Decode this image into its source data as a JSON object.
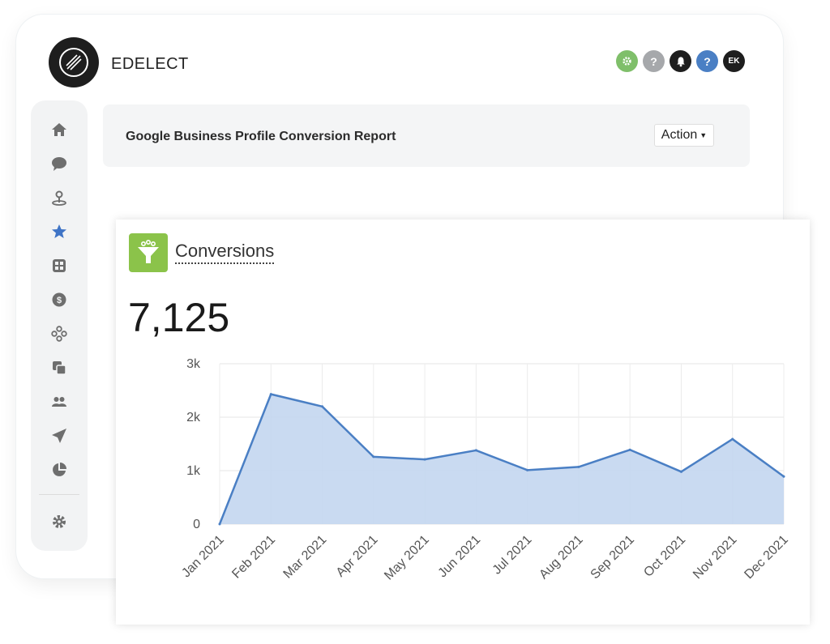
{
  "app": {
    "brand": "EDELECT"
  },
  "header": {
    "icons": [
      "settings-icon",
      "help-icon",
      "bell-icon",
      "help-icon",
      "avatar"
    ],
    "avatar_initials": "EK"
  },
  "sidebar": {
    "items": [
      "home-icon",
      "chat-icon",
      "location-pin-icon",
      "star-icon",
      "grid-icon",
      "dollar-icon",
      "share-icon",
      "copy-icon",
      "users-icon",
      "send-icon",
      "pie-chart-icon",
      "gear-icon"
    ],
    "active_item": "star-icon"
  },
  "report": {
    "title": "Google Business Profile Conversion Report",
    "action_label": "Action"
  },
  "card": {
    "label": "Conversions",
    "total": "7,125"
  },
  "colors": {
    "accent_green": "#8bc34a",
    "line_blue": "#4a7fc4",
    "area_fill": "#c3d6ef"
  },
  "chart_data": {
    "type": "area",
    "x": [
      "Jan 2021",
      "Feb 2021",
      "Mar 2021",
      "Apr 2021",
      "May 2021",
      "Jun 2021",
      "Jul 2021",
      "Aug 2021",
      "Sep 2021",
      "Oct 2021",
      "Nov 2021",
      "Dec 2021"
    ],
    "values": [
      0,
      2430,
      2200,
      1260,
      1210,
      1380,
      1010,
      1070,
      1390,
      980,
      1590,
      890
    ],
    "ylim": [
      0,
      3000
    ],
    "yticks": [
      "0",
      "1k",
      "2k",
      "3k"
    ],
    "grid": true,
    "legend": "none"
  }
}
